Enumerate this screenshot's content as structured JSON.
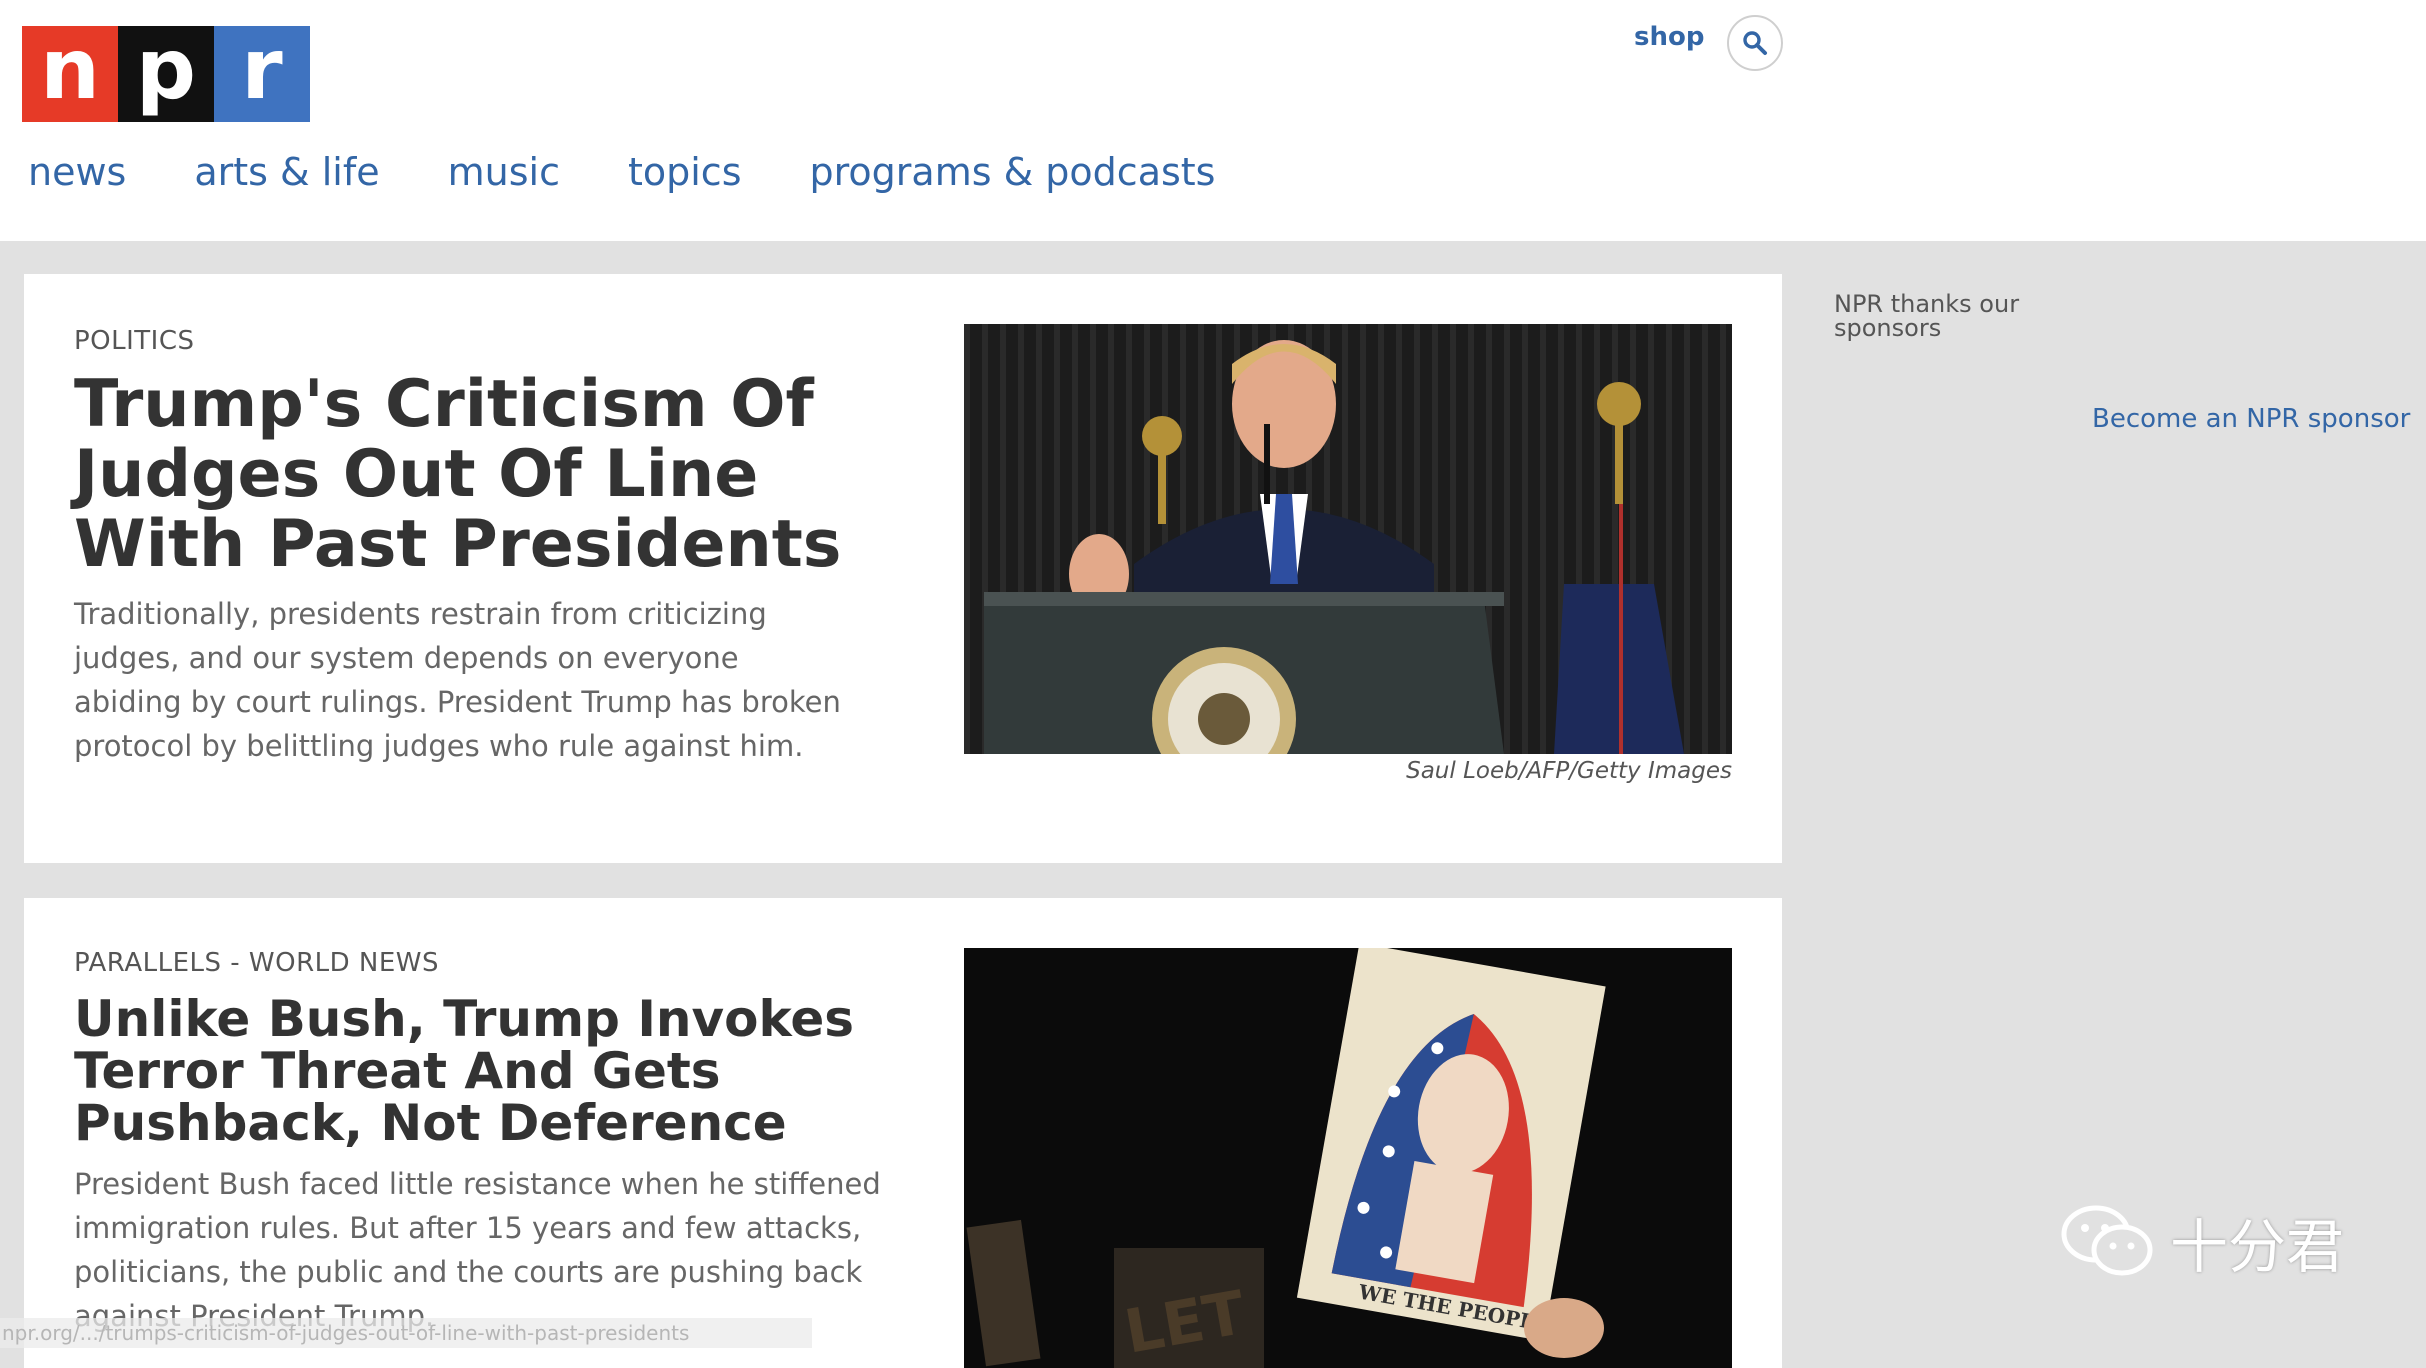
{
  "header": {
    "logo": {
      "letters": [
        "n",
        "p",
        "r"
      ],
      "colors": [
        "#e63a27",
        "#111111",
        "#3f73c0"
      ]
    },
    "shop_label": "shop",
    "search_icon": "search-icon"
  },
  "nav": {
    "items": [
      {
        "label": "news"
      },
      {
        "label": "arts & life"
      },
      {
        "label": "music"
      },
      {
        "label": "topics"
      },
      {
        "label": "programs & podcasts"
      }
    ]
  },
  "stories": [
    {
      "slug": "POLITICS",
      "headline": "Trump's Criticism Of Judges Out Of Line With Past Presidents",
      "teaser": "Traditionally, presidents restrain from criticizing judges, and our system depends on everyone abiding by court rulings. President Trump has broken protocol by belittling judges who rule against him.",
      "photo_credit": "Saul Loeb/AFP/Getty Images"
    },
    {
      "slug": "PARALLELS - WORLD NEWS",
      "headline": "Unlike Bush, Trump Invokes Terror Threat And Gets Pushback, Not Deference",
      "teaser": "President Bush faced little resistance when he stiffened immigration rules. But after 15 years and few attacks, politicians, the public and the courts are pushing back against President Trump.",
      "image_text": "WE THE PEOPLE"
    }
  ],
  "sidebar": {
    "sponsor_thanks": "NPR thanks our sponsors",
    "sponsor_link": "Become an NPR sponsor"
  },
  "status_bar": {
    "url": "npr.org/.../trumps-criticism-of-judges-out-of-line-with-past-presidents"
  },
  "watermark": {
    "text": "十分君"
  },
  "colors": {
    "link_blue": "#3366a6",
    "page_bg": "#e1e1e1",
    "card_bg": "#ffffff",
    "headline": "#333333",
    "teaser": "#666666"
  }
}
